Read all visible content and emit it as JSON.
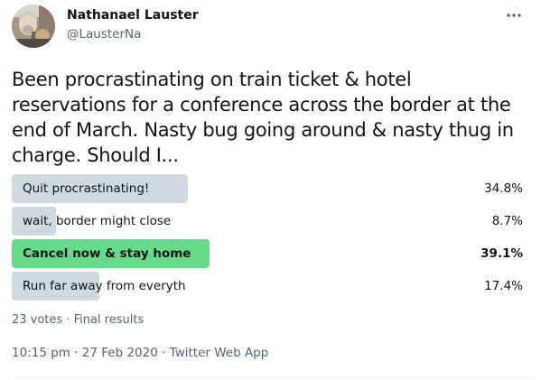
{
  "author": {
    "name": "Nathanael Lauster",
    "handle": "@LausterNa"
  },
  "menu_icon": "more-horizontal-icon",
  "tweet": {
    "text": "Been procrastinating on train ticket & hotel reservations for a conference across the border at the end of March. Nasty bug going around & nasty thug in charge. Should I..."
  },
  "poll": {
    "options": [
      {
        "label": "Quit procrastinating!",
        "percent": "34.8%",
        "fraction": 0.348,
        "winner": false
      },
      {
        "label": "wait, border might close",
        "percent": "8.7%",
        "fraction": 0.087,
        "winner": false
      },
      {
        "label": "Cancel now & stay home",
        "percent": "39.1%",
        "fraction": 0.391,
        "winner": true
      },
      {
        "label": "Run far away from everyth",
        "percent": "17.4%",
        "fraction": 0.174,
        "winner": false
      }
    ],
    "meta": "23 votes · Final results"
  },
  "timestamp": "10:15 pm · 27 Feb 2020 · Twitter Web App",
  "colors": {
    "bar": "#cfd9de",
    "winner_bar": "#66dc8b",
    "secondary_text": "#536471"
  }
}
